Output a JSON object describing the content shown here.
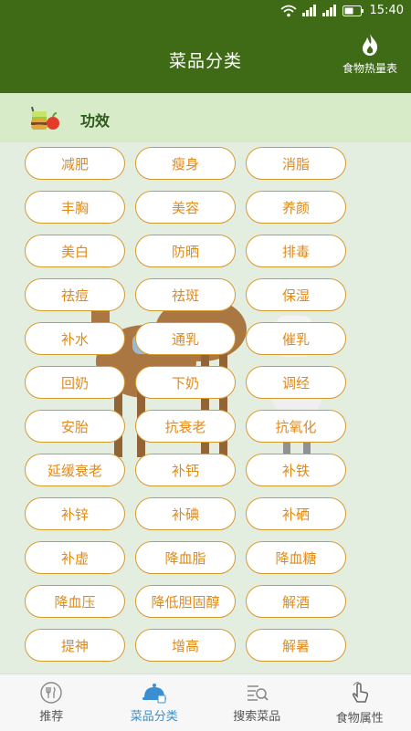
{
  "status_bar": {
    "time": "15:40"
  },
  "header": {
    "title": "菜品分类",
    "calorie_label": "食物热量表"
  },
  "section": {
    "title": "功效"
  },
  "categories": [
    "减肥",
    "瘦身",
    "消脂",
    "丰胸",
    "美容",
    "养颜",
    "美白",
    "防晒",
    "排毒",
    "祛痘",
    "祛斑",
    "保湿",
    "补水",
    "通乳",
    "催乳",
    "回奶",
    "下奶",
    "调经",
    "安胎",
    "抗衰老",
    "抗氧化",
    "延缓衰老",
    "补钙",
    "补铁",
    "补锌",
    "补碘",
    "补硒",
    "补虚",
    "降血脂",
    "降血糖",
    "降血压",
    "降低胆固醇",
    "解酒",
    "提神",
    "增高",
    "解暑"
  ],
  "tabs": [
    {
      "label": "推荐",
      "icon": "fork-knife-icon"
    },
    {
      "label": "菜品分类",
      "icon": "dish-cover-icon"
    },
    {
      "label": "搜索菜品",
      "icon": "search-list-icon"
    },
    {
      "label": "食物属性",
      "icon": "hand-pointer-icon"
    }
  ],
  "colors": {
    "header_bg": "#3f6b17",
    "chip_text": "#e08a1a",
    "chip_border": "#d59a2c",
    "active_tab": "#3a8fd0"
  }
}
